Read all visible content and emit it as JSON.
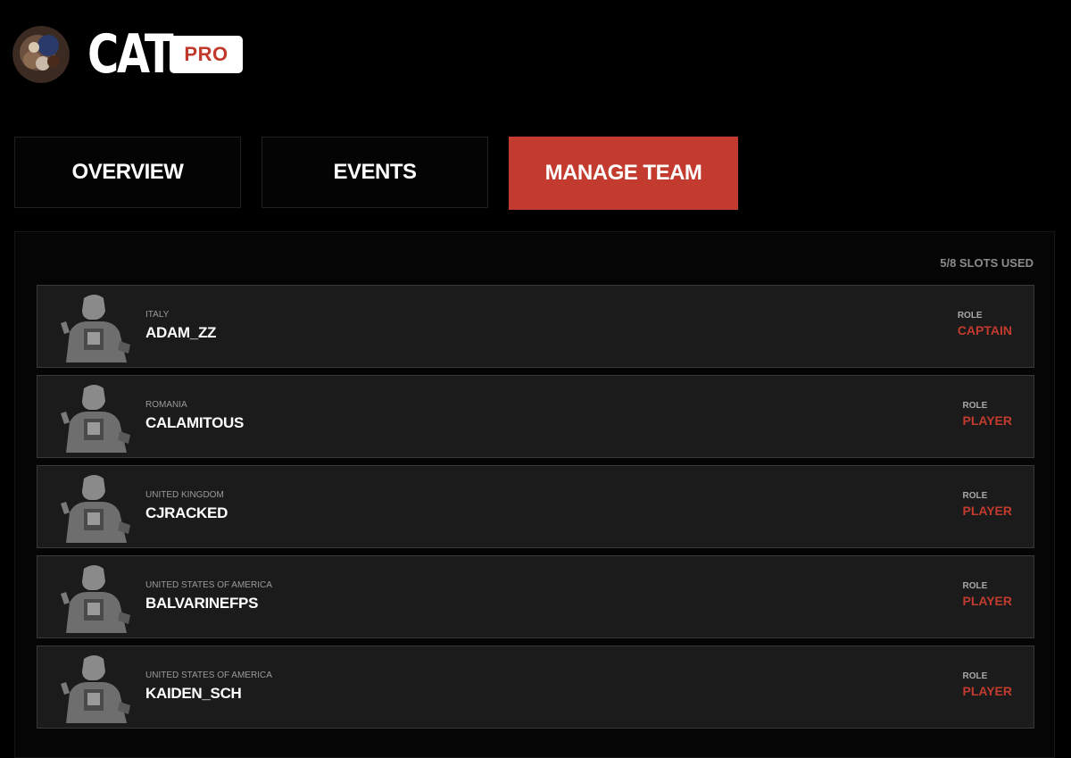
{
  "team": {
    "name": "CAT",
    "tier": "PRO"
  },
  "tabs": [
    {
      "label": "OVERVIEW",
      "active": false
    },
    {
      "label": "EVENTS",
      "active": false
    },
    {
      "label": "MANAGE TEAM",
      "active": true
    }
  ],
  "roster": {
    "slots_text": "5/8 SLOTS USED",
    "role_label": "ROLE",
    "players": [
      {
        "country": "ITALY",
        "name": "ADAM_ZZ",
        "role": "CAPTAIN"
      },
      {
        "country": "ROMANIA",
        "name": "CALAMITOUS",
        "role": "PLAYER"
      },
      {
        "country": "UNITED KINGDOM",
        "name": "CJRACKED",
        "role": "PLAYER"
      },
      {
        "country": "UNITED STATES OF AMERICA",
        "name": "BALVARINEFPS",
        "role": "PLAYER"
      },
      {
        "country": "UNITED STATES OF AMERICA",
        "name": "KAIDEN_SCH",
        "role": "PLAYER"
      }
    ]
  },
  "colors": {
    "accent": "#c23b2e",
    "background": "#000000",
    "row": "#1b1b1b"
  },
  "icons": {
    "team_logo": "team-logo",
    "player_avatar": "player-avatar"
  }
}
